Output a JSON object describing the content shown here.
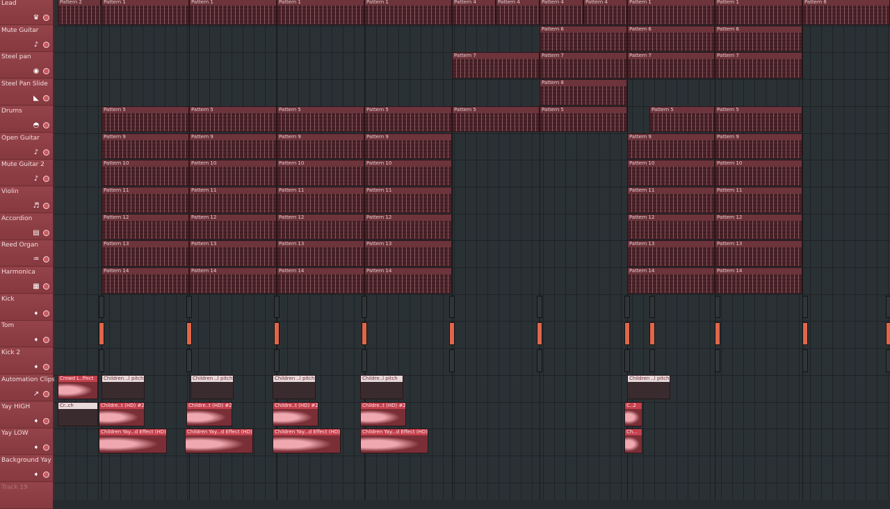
{
  "tracks": [
    {
      "name": "Lead",
      "icon": "crown-icon"
    },
    {
      "name": "Mute Guitar",
      "icon": "guitar-icon"
    },
    {
      "name": "Steel pan",
      "icon": "circle-icon"
    },
    {
      "name": "Steel Pan Slide",
      "icon": "slide-icon"
    },
    {
      "name": "Drums",
      "icon": "drum-icon"
    },
    {
      "name": "Open Guitar",
      "icon": "guitar-icon"
    },
    {
      "name": "Mute Guitar 2",
      "icon": "guitar-icon"
    },
    {
      "name": "Violin",
      "icon": "violin-icon"
    },
    {
      "name": "Accordion",
      "icon": "accordion-icon"
    },
    {
      "name": "Reed Organ",
      "icon": "organ-icon"
    },
    {
      "name": "Harmonica",
      "icon": "harmonica-icon"
    },
    {
      "name": "Kick",
      "icon": "arrow-icon"
    },
    {
      "name": "Tom",
      "icon": "arrow-icon"
    },
    {
      "name": "Kick 2",
      "icon": "arrow-icon"
    },
    {
      "name": "Automation Clips",
      "icon": "automation-icon"
    },
    {
      "name": "Yay HIGH",
      "icon": "arrow-icon"
    },
    {
      "name": "Yay LOW",
      "icon": "arrow-icon"
    },
    {
      "name": "Background Yay",
      "icon": "arrow-icon"
    },
    {
      "name": "Track 19",
      "icon": ""
    }
  ],
  "clips": {
    "c0": "Pattern 2",
    "c1": "Pattern 1",
    "c2": "Pattern 4",
    "c3": "Pattern 6",
    "c4": "Pattern 7",
    "c5": "Pattern 8",
    "c6": "Pattern 5",
    "c7": "Pattern 9",
    "c8": "Pattern 10",
    "c9": "Pattern 11",
    "c10": "Pattern 12",
    "c11": "Pattern 13",
    "c12": "Pattern 14",
    "a1": "Crowd L..ffect",
    "a2": "Children ..l pitch",
    "a3": "Childre..l pitch",
    "a4": "Cr..ch",
    "a5": "Childre..t (HD) #2",
    "a6": "Children Yay...d Effect (HD)",
    "a7": "C..2",
    "a8": "Ch..."
  },
  "colors": {
    "header_bg": "#8c3e45",
    "playlist_bg": "#2a3135",
    "clip_bg": "#5a2a30"
  }
}
